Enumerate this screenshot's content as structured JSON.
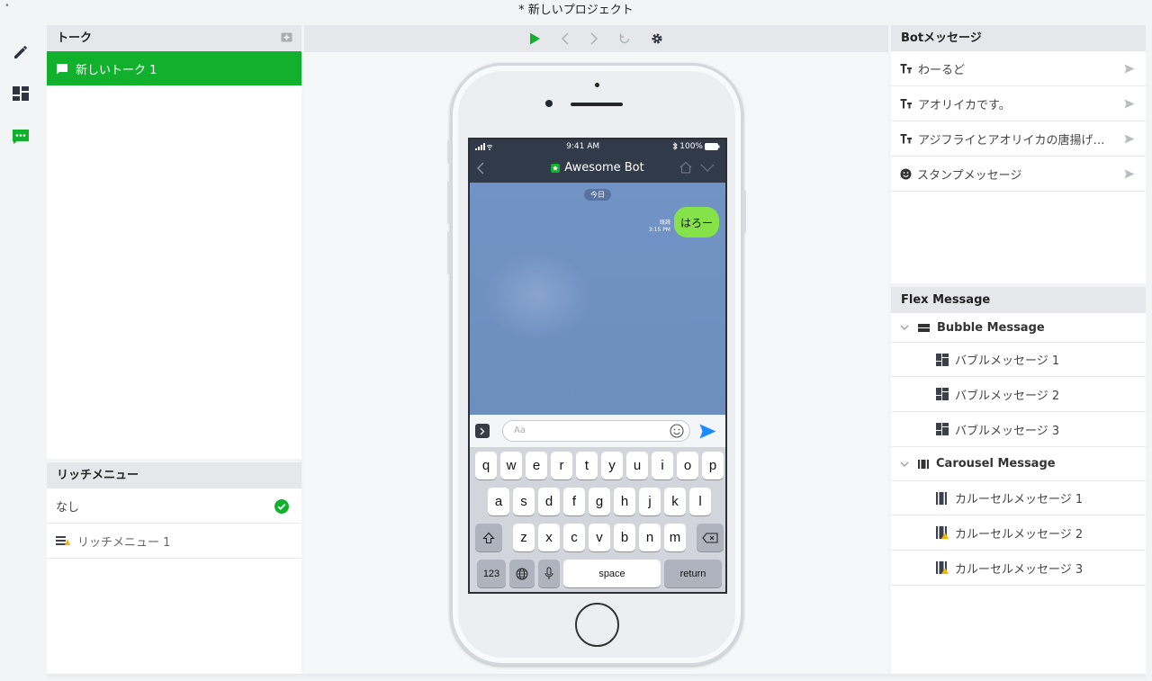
{
  "window": {
    "title": "* 新しいプロジェクト",
    "dot": "•"
  },
  "colors": {
    "accent": "#11b12e",
    "header_bg": "#e5e7ea",
    "phone_bar": "#313a48",
    "bubble": "#85e249",
    "send": "#1a8cff"
  },
  "sidebar": {
    "talks_header": "トーク",
    "talks": [
      {
        "label": "新しいトーク 1",
        "selected": true
      }
    ],
    "rich_menu_header": "リッチメニュー",
    "rich_menu_items": [
      {
        "label": "なし",
        "checked": true
      },
      {
        "label": "リッチメニュー 1",
        "checked": false
      }
    ]
  },
  "toolbar": {
    "icons": [
      "play-icon",
      "back-icon",
      "forward-icon",
      "refresh-icon",
      "gear-icon"
    ]
  },
  "phone": {
    "time": "9:41 AM",
    "battery": "100%",
    "bot_name": "Awesome Bot",
    "date_pill": "今日",
    "read_label": "既読",
    "message_time": "3:15 PM",
    "message": "はろー",
    "input_placeholder": "Aa",
    "keyboard": {
      "row1": [
        "q",
        "w",
        "e",
        "r",
        "t",
        "y",
        "u",
        "i",
        "o",
        "p"
      ],
      "row2": [
        "a",
        "s",
        "d",
        "f",
        "g",
        "h",
        "j",
        "k",
        "l"
      ],
      "row3": [
        "z",
        "x",
        "c",
        "v",
        "b",
        "n",
        "m"
      ],
      "num_key": "123",
      "space_key": "space",
      "return_key": "return"
    }
  },
  "bot_messages": {
    "header": "Botメッセージ",
    "items": [
      {
        "label": "わーるど",
        "type": "text"
      },
      {
        "label": "アオリイカです。",
        "type": "text"
      },
      {
        "label": "アジフライとアオリイカの唐揚げ…",
        "type": "text"
      },
      {
        "label": "スタンプメッセージ",
        "type": "sticker"
      }
    ]
  },
  "flex": {
    "header": "Flex Message",
    "bubble_group": "Bubble Message",
    "bubble_items": [
      "バブルメッセージ 1",
      "バブルメッセージ 2",
      "バブルメッセージ 3"
    ],
    "carousel_group": "Carousel Message",
    "carousel_items": [
      "カルーセルメッセージ 1",
      "カルーセルメッセージ 2",
      "カルーセルメッセージ 3"
    ]
  }
}
